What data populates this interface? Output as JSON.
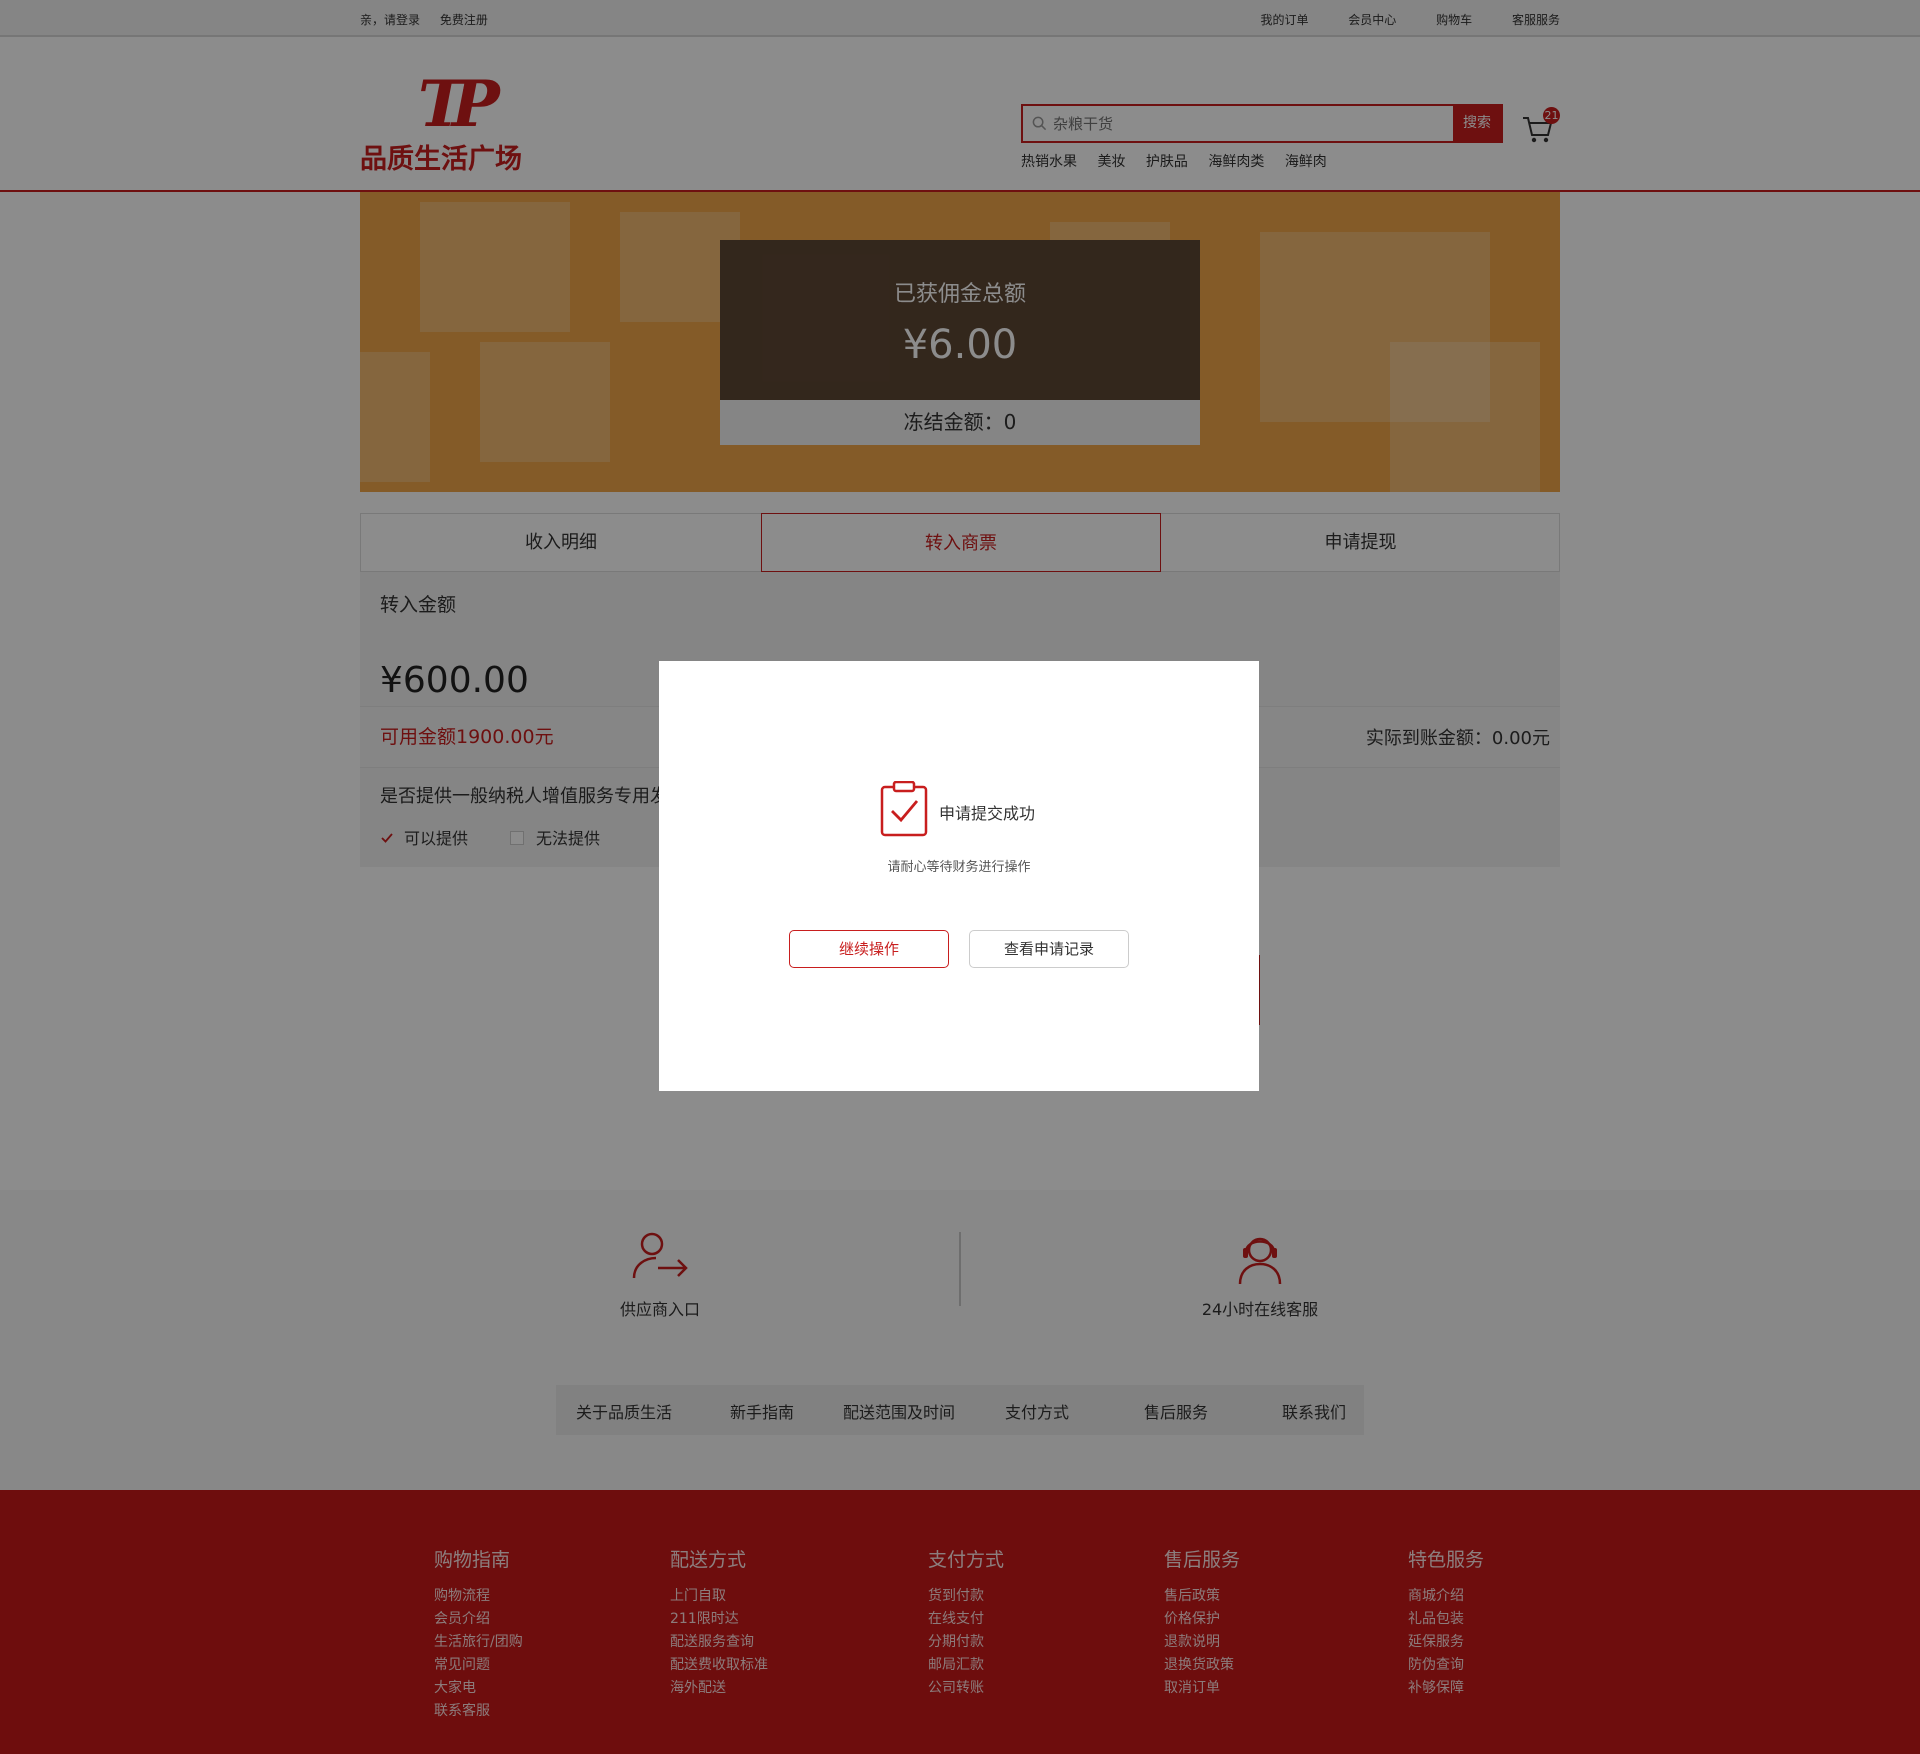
{
  "topbar": {
    "greeting": "亲，请登录",
    "register": "免费注册",
    "my_orders": "我的订单",
    "member_center": "会员中心",
    "cart": "购物车",
    "customer_service": "客服服务"
  },
  "header": {
    "logo_mark": "ТP",
    "logo_name": "品质生活广场",
    "search_placeholder": "杂粮干货",
    "search_button": "搜索",
    "cart_count": "21",
    "hot_words": [
      "热销水果",
      "美妆",
      "护肤品",
      "海鲜肉类",
      "海鲜肉"
    ]
  },
  "banner": {
    "total_label": "已获佣金总额",
    "total_amount": "¥6.00",
    "frozen": "冻结金额：0"
  },
  "tabs": [
    "收入明细",
    "转入商票",
    "申请提现"
  ],
  "form": {
    "amount_label": "转入金额",
    "amount_value": "¥600.00",
    "available": "可用金额1900.00元",
    "actual": "实际到账金额：0.00元",
    "question": "是否提供一般纳税人增值服务专用发",
    "option_yes": "可以提供",
    "option_no": "无法提供"
  },
  "services": {
    "supplier": "供应商入口",
    "support": "24小时在线客服",
    "links": [
      "关于品质生活",
      "新手指南",
      "配送范围及时间",
      "支付方式",
      "售后服务",
      "联系我们"
    ]
  },
  "footer": {
    "columns": [
      {
        "title": "购物指南",
        "items": [
          "购物流程",
          "会员介绍",
          "生活旅行/团购",
          "常见问题",
          "大家电",
          "联系客服"
        ]
      },
      {
        "title": "配送方式",
        "items": [
          "上门自取",
          "211限时达",
          "配送服务查询",
          "配送费收取标准",
          "海外配送"
        ]
      },
      {
        "title": "支付方式",
        "items": [
          "货到付款",
          "在线支付",
          "分期付款",
          "邮局汇款",
          "公司转账"
        ]
      },
      {
        "title": "售后服务",
        "items": [
          "售后政策",
          "价格保护",
          "退款说明",
          "退换货政策",
          "取消订单"
        ]
      },
      {
        "title": "特色服务",
        "items": [
          "商城介绍",
          "礼品包装",
          "延保服务",
          "防伪查询",
          "补够保障"
        ]
      }
    ]
  },
  "modal": {
    "title": "申请提交成功",
    "subtitle": "请耐心等待财务进行操作",
    "continue": "继续操作",
    "view_records": "查看申请记录"
  },
  "colors": {
    "brand_red": "#c81e1e",
    "banner_orange": "#f0a74a",
    "footer_red": "#c81818"
  }
}
